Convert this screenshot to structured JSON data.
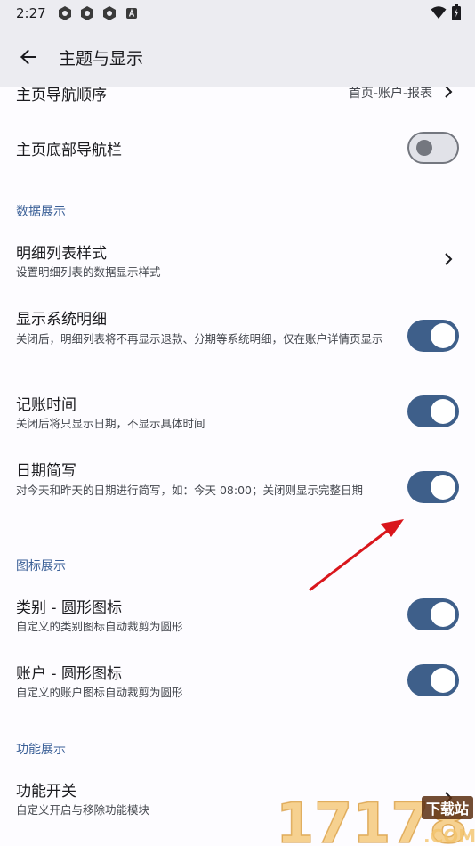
{
  "status_bar": {
    "time": "2:27"
  },
  "app_bar": {
    "title": "主题与显示"
  },
  "rows": {
    "home_nav_order": {
      "title": "主页导航顺序",
      "value": "首页-账户-报表"
    },
    "home_bottom_nav": {
      "title": "主页底部导航栏",
      "switch": "off"
    },
    "detail_list_style": {
      "title": "明细列表样式",
      "subtitle": "设置明细列表的数据显示样式"
    },
    "show_system_detail": {
      "title": "显示系统明细",
      "subtitle": "关闭后，明细列表将不再显示退款、分期等系统明细，仅在账户详情页显示",
      "switch": "on"
    },
    "record_time": {
      "title": "记账时间",
      "subtitle": "关闭后将只显示日期，不显示具体时间",
      "switch": "on"
    },
    "date_short": {
      "title": "日期简写",
      "subtitle": "对今天和昨天的日期进行简写，如：今天 08:00；关闭则显示完整日期",
      "switch": "on"
    },
    "category_round_icon": {
      "title": "类别 - 圆形图标",
      "subtitle": "自定义的类别图标自动裁剪为圆形",
      "switch": "on"
    },
    "account_round_icon": {
      "title": "账户 - 圆形图标",
      "subtitle": "自定义的账户图标自动裁剪为圆形",
      "switch": "on"
    },
    "feature_switch": {
      "title": "功能开关",
      "subtitle": "自定义开启与移除功能模块"
    }
  },
  "sections": {
    "data_display": "数据展示",
    "icon_display": "图标展示",
    "feature_display": "功能展示"
  },
  "watermark": {
    "text": "17178",
    "badge": "下载站",
    "domain": ".COM"
  },
  "colors": {
    "accent": "#3e5f8a",
    "section_header": "#3c6198",
    "app_bar_bg": "#ececf1",
    "arrow": "#d9161c"
  }
}
